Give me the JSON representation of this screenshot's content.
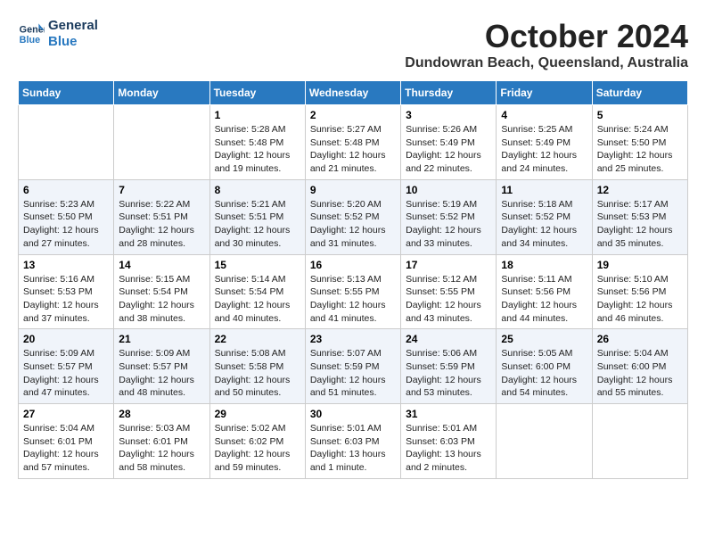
{
  "logo": {
    "line1": "General",
    "line2": "Blue"
  },
  "title": "October 2024",
  "location": "Dundowran Beach, Queensland, Australia",
  "weekdays": [
    "Sunday",
    "Monday",
    "Tuesday",
    "Wednesday",
    "Thursday",
    "Friday",
    "Saturday"
  ],
  "weeks": [
    [
      {
        "day": "",
        "content": ""
      },
      {
        "day": "",
        "content": ""
      },
      {
        "day": "1",
        "content": "Sunrise: 5:28 AM\nSunset: 5:48 PM\nDaylight: 12 hours and 19 minutes."
      },
      {
        "day": "2",
        "content": "Sunrise: 5:27 AM\nSunset: 5:48 PM\nDaylight: 12 hours and 21 minutes."
      },
      {
        "day": "3",
        "content": "Sunrise: 5:26 AM\nSunset: 5:49 PM\nDaylight: 12 hours and 22 minutes."
      },
      {
        "day": "4",
        "content": "Sunrise: 5:25 AM\nSunset: 5:49 PM\nDaylight: 12 hours and 24 minutes."
      },
      {
        "day": "5",
        "content": "Sunrise: 5:24 AM\nSunset: 5:50 PM\nDaylight: 12 hours and 25 minutes."
      }
    ],
    [
      {
        "day": "6",
        "content": "Sunrise: 5:23 AM\nSunset: 5:50 PM\nDaylight: 12 hours and 27 minutes."
      },
      {
        "day": "7",
        "content": "Sunrise: 5:22 AM\nSunset: 5:51 PM\nDaylight: 12 hours and 28 minutes."
      },
      {
        "day": "8",
        "content": "Sunrise: 5:21 AM\nSunset: 5:51 PM\nDaylight: 12 hours and 30 minutes."
      },
      {
        "day": "9",
        "content": "Sunrise: 5:20 AM\nSunset: 5:52 PM\nDaylight: 12 hours and 31 minutes."
      },
      {
        "day": "10",
        "content": "Sunrise: 5:19 AM\nSunset: 5:52 PM\nDaylight: 12 hours and 33 minutes."
      },
      {
        "day": "11",
        "content": "Sunrise: 5:18 AM\nSunset: 5:52 PM\nDaylight: 12 hours and 34 minutes."
      },
      {
        "day": "12",
        "content": "Sunrise: 5:17 AM\nSunset: 5:53 PM\nDaylight: 12 hours and 35 minutes."
      }
    ],
    [
      {
        "day": "13",
        "content": "Sunrise: 5:16 AM\nSunset: 5:53 PM\nDaylight: 12 hours and 37 minutes."
      },
      {
        "day": "14",
        "content": "Sunrise: 5:15 AM\nSunset: 5:54 PM\nDaylight: 12 hours and 38 minutes."
      },
      {
        "day": "15",
        "content": "Sunrise: 5:14 AM\nSunset: 5:54 PM\nDaylight: 12 hours and 40 minutes."
      },
      {
        "day": "16",
        "content": "Sunrise: 5:13 AM\nSunset: 5:55 PM\nDaylight: 12 hours and 41 minutes."
      },
      {
        "day": "17",
        "content": "Sunrise: 5:12 AM\nSunset: 5:55 PM\nDaylight: 12 hours and 43 minutes."
      },
      {
        "day": "18",
        "content": "Sunrise: 5:11 AM\nSunset: 5:56 PM\nDaylight: 12 hours and 44 minutes."
      },
      {
        "day": "19",
        "content": "Sunrise: 5:10 AM\nSunset: 5:56 PM\nDaylight: 12 hours and 46 minutes."
      }
    ],
    [
      {
        "day": "20",
        "content": "Sunrise: 5:09 AM\nSunset: 5:57 PM\nDaylight: 12 hours and 47 minutes."
      },
      {
        "day": "21",
        "content": "Sunrise: 5:09 AM\nSunset: 5:57 PM\nDaylight: 12 hours and 48 minutes."
      },
      {
        "day": "22",
        "content": "Sunrise: 5:08 AM\nSunset: 5:58 PM\nDaylight: 12 hours and 50 minutes."
      },
      {
        "day": "23",
        "content": "Sunrise: 5:07 AM\nSunset: 5:59 PM\nDaylight: 12 hours and 51 minutes."
      },
      {
        "day": "24",
        "content": "Sunrise: 5:06 AM\nSunset: 5:59 PM\nDaylight: 12 hours and 53 minutes."
      },
      {
        "day": "25",
        "content": "Sunrise: 5:05 AM\nSunset: 6:00 PM\nDaylight: 12 hours and 54 minutes."
      },
      {
        "day": "26",
        "content": "Sunrise: 5:04 AM\nSunset: 6:00 PM\nDaylight: 12 hours and 55 minutes."
      }
    ],
    [
      {
        "day": "27",
        "content": "Sunrise: 5:04 AM\nSunset: 6:01 PM\nDaylight: 12 hours and 57 minutes."
      },
      {
        "day": "28",
        "content": "Sunrise: 5:03 AM\nSunset: 6:01 PM\nDaylight: 12 hours and 58 minutes."
      },
      {
        "day": "29",
        "content": "Sunrise: 5:02 AM\nSunset: 6:02 PM\nDaylight: 12 hours and 59 minutes."
      },
      {
        "day": "30",
        "content": "Sunrise: 5:01 AM\nSunset: 6:03 PM\nDaylight: 13 hours and 1 minute."
      },
      {
        "day": "31",
        "content": "Sunrise: 5:01 AM\nSunset: 6:03 PM\nDaylight: 13 hours and 2 minutes."
      },
      {
        "day": "",
        "content": ""
      },
      {
        "day": "",
        "content": ""
      }
    ]
  ]
}
